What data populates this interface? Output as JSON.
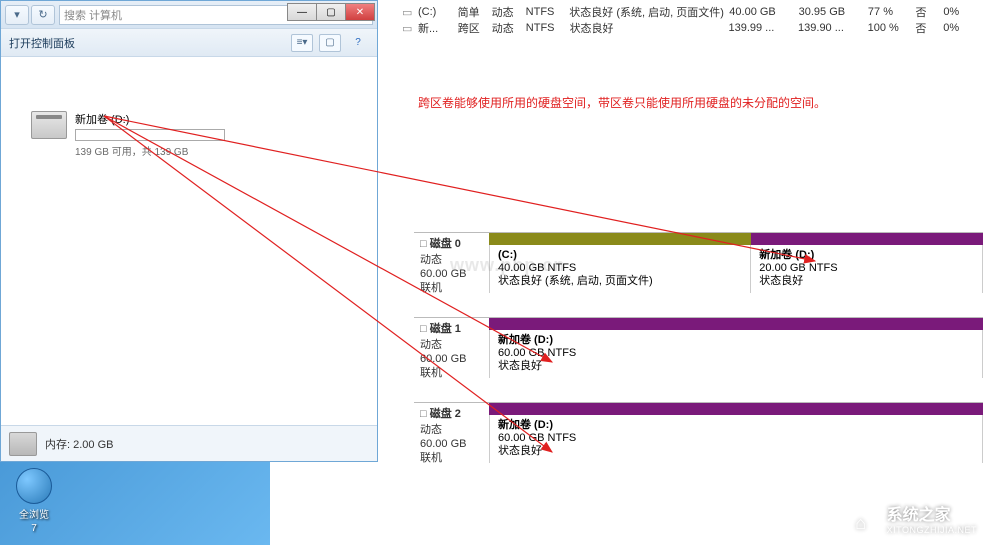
{
  "explorer": {
    "search_placeholder": "搜索 计算机",
    "toolbar_open": "打开控制面板",
    "drive": {
      "name_label": "新加卷 (D:)",
      "stats_label": "139 GB 可用，共 139 GB"
    },
    "status_label": "内存: 2.00 GB"
  },
  "desktop_icon": {
    "label1": "全浏览",
    "label2": "7"
  },
  "volumes": [
    {
      "icon": "▭",
      "name": "(C:)",
      "layout": "简单",
      "type": "动态",
      "fs": "NTFS",
      "status": "状态良好 (系统, 启动, 页面文件)",
      "cap": "40.00 GB",
      "free": "30.95 GB",
      "pct": "77 %",
      "fault": "否",
      "overhead": "0%"
    },
    {
      "icon": "▭",
      "name": "新...",
      "layout": "跨区",
      "type": "动态",
      "fs": "NTFS",
      "status": "状态良好",
      "cap": "139.99 ...",
      "free": "139.90 ...",
      "pct": "100 %",
      "fault": "否",
      "overhead": "0%"
    }
  ],
  "annotation_text": "跨区卷能够使用所用的硬盘空间，带区卷只能使用所用硬盘的未分配的空间。",
  "disks": [
    {
      "name": "磁盘 0",
      "dtype": "动态",
      "size": "60.00 GB",
      "state": "联机",
      "strips": [
        {
          "color": "olive",
          "width": "53%",
          "name": "(C:)",
          "line2": "40.00 GB NTFS",
          "line3": "状态良好 (系统, 启动, 页面文件)"
        },
        {
          "color": "purple",
          "width": "47%",
          "name": "新加卷  (D:)",
          "line2": "20.00 GB NTFS",
          "line3": "状态良好"
        }
      ]
    },
    {
      "name": "磁盘 1",
      "dtype": "动态",
      "size": "60.00 GB",
      "state": "联机",
      "strips": [
        {
          "color": "purple",
          "width": "100%",
          "name": "新加卷  (D:)",
          "line2": "60.00 GB NTFS",
          "line3": "状态良好"
        }
      ]
    },
    {
      "name": "磁盘 2",
      "dtype": "动态",
      "size": "60.00 GB",
      "state": "联机",
      "strips": [
        {
          "color": "purple",
          "width": "100%",
          "name": "新加卷  (D:)",
          "line2": "60.00 GB NTFS",
          "line3": "状态良好"
        }
      ]
    }
  ],
  "watermark_center": "www.php.cn",
  "watermark_logo": {
    "cn": "系统之家",
    "en": "XITONGZHIJIA.NET"
  }
}
